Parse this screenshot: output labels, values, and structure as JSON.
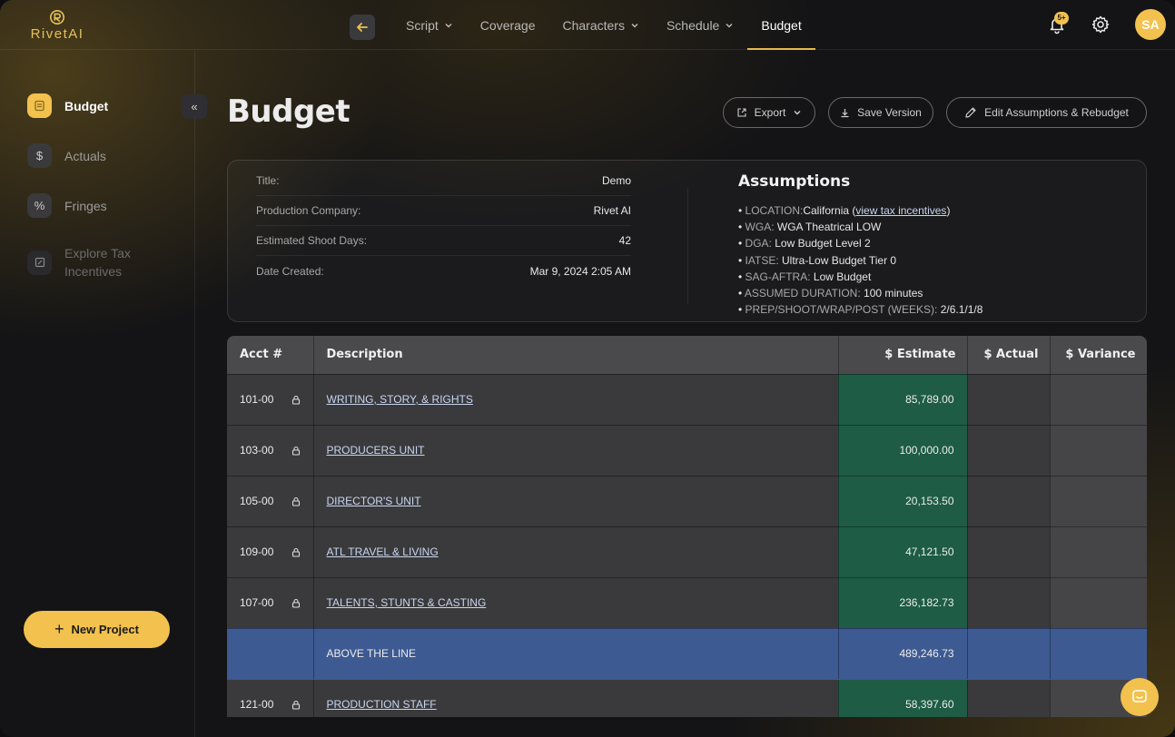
{
  "app": {
    "logo_text": "RivetAI"
  },
  "nav": {
    "items": [
      {
        "label": "Script",
        "has_dropdown": true
      },
      {
        "label": "Coverage",
        "has_dropdown": false
      },
      {
        "label": "Characters",
        "has_dropdown": true
      },
      {
        "label": "Schedule",
        "has_dropdown": true
      },
      {
        "label": "Budget",
        "has_dropdown": false,
        "active": true
      }
    ],
    "notification_badge": "5+",
    "avatar_initials": "SA"
  },
  "sidebar": {
    "items": [
      {
        "label": "Budget",
        "icon": "budget-icon",
        "active": true
      },
      {
        "label": "Actuals",
        "icon": "dollar-icon"
      },
      {
        "label": "Fringes",
        "icon": "percent-icon"
      },
      {
        "label": "Explore Tax Incentives",
        "icon": "tax-icon",
        "muted": true
      }
    ],
    "new_project_label": "New Project"
  },
  "page": {
    "title": "Budget",
    "actions": {
      "export_label": "Export",
      "save_version_label": "Save Version",
      "edit_label": "Edit Assumptions & Rebudget"
    }
  },
  "info": {
    "rows": [
      {
        "label": "Title:",
        "value": "Demo"
      },
      {
        "label": "Production Company:",
        "value": "Rivet AI"
      },
      {
        "label": "Estimated Shoot Days:",
        "value": "42"
      },
      {
        "label": "Date Created:",
        "value": "Mar 9, 2024 2:05 AM"
      }
    ]
  },
  "assumptions": {
    "title": "Assumptions",
    "location_label": "LOCATION:",
    "location_value": "California",
    "location_link": "view tax incentives",
    "items": [
      {
        "label": "WGA:",
        "value": "WGA Theatrical LOW"
      },
      {
        "label": "DGA:",
        "value": "Low Budget Level 2"
      },
      {
        "label": "IATSE:",
        "value": "Ultra-Low Budget Tier 0"
      },
      {
        "label": "SAG-AFTRA:",
        "value": "Low Budget"
      },
      {
        "label": "ASSUMED DURATION:",
        "value": "100 minutes"
      },
      {
        "label": "PREP/SHOOT/WRAP/POST (WEEKS):",
        "value": "2/6.1/1/8"
      }
    ]
  },
  "table": {
    "headers": [
      "Acct #",
      "Description",
      "$ Estimate",
      "$ Actual",
      "$ Variance"
    ],
    "rows": [
      {
        "acct": "101-00",
        "description": "WRITING, STORY, & RIGHTS",
        "estimate": "85,789.00",
        "actual": "",
        "variance": ""
      },
      {
        "acct": "103-00",
        "description": "PRODUCERS UNIT",
        "estimate": "100,000.00",
        "actual": "",
        "variance": ""
      },
      {
        "acct": "105-00",
        "description": "DIRECTOR'S UNIT",
        "estimate": "20,153.50",
        "actual": "",
        "variance": ""
      },
      {
        "acct": "109-00",
        "description": "ATL TRAVEL & LIVING",
        "estimate": "47,121.50",
        "actual": "",
        "variance": ""
      },
      {
        "acct": "107-00",
        "description": "TALENTS, STUNTS & CASTING",
        "estimate": "236,182.73",
        "actual": "",
        "variance": ""
      },
      {
        "acct": "",
        "description": "ABOVE THE LINE",
        "estimate": "489,246.73",
        "actual": "",
        "variance": "",
        "summary": true
      },
      {
        "acct": "121-00",
        "description": "PRODUCTION STAFF",
        "estimate": "58,397.60",
        "actual": "",
        "variance": ""
      }
    ]
  },
  "colors": {
    "accent": "#f2c14e",
    "estimate_bg": "#1e5c45",
    "summary_bg": "#3e5a92"
  }
}
